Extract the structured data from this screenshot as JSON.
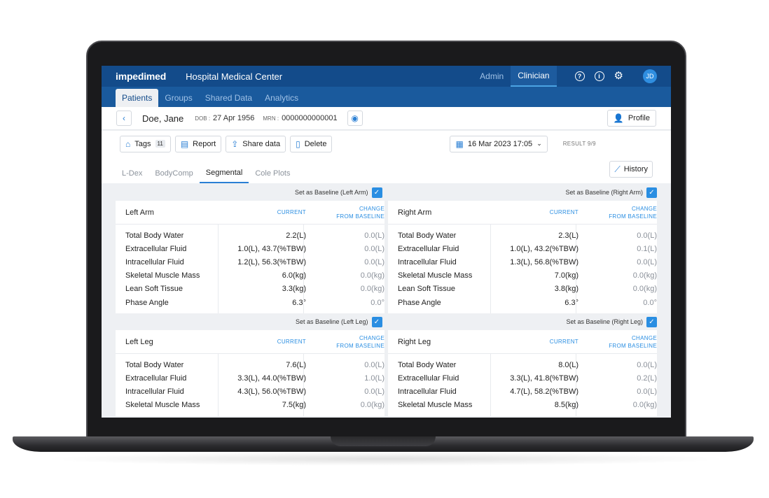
{
  "app": {
    "logo": "impedimed",
    "org_name": "Hospital Medical Center",
    "roles": [
      "Admin",
      "Clinician"
    ],
    "active_role": "Clinician",
    "avatar_initials": "JD"
  },
  "nav": {
    "tabs": [
      "Patients",
      "Groups",
      "Shared Data",
      "Analytics"
    ],
    "active": "Patients"
  },
  "patient": {
    "name": "Doe, Jane",
    "dob_label": "DOB :",
    "dob": "27 Apr 1956",
    "mrn_label": "MRN :",
    "mrn": "0000000000001",
    "profile_label": "Profile"
  },
  "actions": {
    "tags_label": "Tags",
    "tags_count": "11",
    "report_label": "Report",
    "share_label": "Share data",
    "delete_label": "Delete",
    "date": "16 Mar 2023 17:05",
    "result": "RESULT 9/9"
  },
  "subtabs": {
    "items": [
      "L-Dex",
      "BodyComp",
      "Segmental",
      "Cole Plots"
    ],
    "active": "Segmental",
    "history_label": "History"
  },
  "columns": {
    "current": "CURRENT",
    "change_line1": "CHANGE",
    "change_line2": "FROM BASELINE"
  },
  "panels": {
    "left_arm": {
      "baseline_label": "Set as Baseline (Left Arm)",
      "title": "Left Arm",
      "rows": [
        {
          "label": "Total Body Water",
          "current": "2.2(L)",
          "change": "0.0(L)"
        },
        {
          "label": "Extracellular Fluid",
          "current": "1.0(L), 43.7(%TBW)",
          "change": "0.0(L)"
        },
        {
          "label": "Intracellular Fluid",
          "current": "1.2(L), 56.3(%TBW)",
          "change": "0.0(L)"
        },
        {
          "label": "Skeletal Muscle Mass",
          "current": "6.0(kg)",
          "change": "0.0(kg)"
        },
        {
          "label": "Lean Soft Tissue",
          "current": "3.3(kg)",
          "change": "0.0(kg)"
        },
        {
          "label": "Phase Angle",
          "current": "6.3°",
          "change": "0.0°"
        }
      ]
    },
    "right_arm": {
      "baseline_label": "Set as Baseline (Right Arm)",
      "title": "Right Arm",
      "rows": [
        {
          "label": "Total Body Water",
          "current": "2.3(L)",
          "change": "0.0(L)"
        },
        {
          "label": "Extracellular Fluid",
          "current": "1.0(L), 43.2(%TBW)",
          "change": "0.1(L)"
        },
        {
          "label": "Intracellular Fluid",
          "current": "1.3(L), 56.8(%TBW)",
          "change": "0.0(L)"
        },
        {
          "label": "Skeletal Muscle Mass",
          "current": "7.0(kg)",
          "change": "0.0(kg)"
        },
        {
          "label": "Lean Soft Tissue",
          "current": "3.8(kg)",
          "change": "0.0(kg)"
        },
        {
          "label": "Phase Angle",
          "current": "6.3°",
          "change": "0.0°"
        }
      ]
    },
    "left_leg": {
      "baseline_label": "Set as Baseline (Left Leg)",
      "title": "Left Leg",
      "rows": [
        {
          "label": "Total Body Water",
          "current": "7.6(L)",
          "change": "0.0(L)"
        },
        {
          "label": "Extracellular Fluid",
          "current": "3.3(L), 44.0(%TBW)",
          "change": "1.0(L)"
        },
        {
          "label": "Intracellular Fluid",
          "current": "4.3(L), 56.0(%TBW)",
          "change": "0.0(L)"
        },
        {
          "label": "Skeletal Muscle Mass",
          "current": "7.5(kg)",
          "change": "0.0(kg)"
        }
      ]
    },
    "right_leg": {
      "baseline_label": "Set as Baseline (Right Leg)",
      "title": "Right Leg",
      "rows": [
        {
          "label": "Total Body Water",
          "current": "8.0(L)",
          "change": "0.0(L)"
        },
        {
          "label": "Extracellular Fluid",
          "current": "3.3(L), 41.8(%TBW)",
          "change": "0.2(L)"
        },
        {
          "label": "Intracellular Fluid",
          "current": "4.7(L), 58.2(%TBW)",
          "change": "0.0(L)"
        },
        {
          "label": "Skeletal Muscle Mass",
          "current": "8.5(kg)",
          "change": "0.0(kg)"
        }
      ]
    }
  },
  "colors": {
    "header_bg": "#134b8a",
    "nav_bg": "#1a5a9d",
    "accent": "#2a8ee2"
  }
}
